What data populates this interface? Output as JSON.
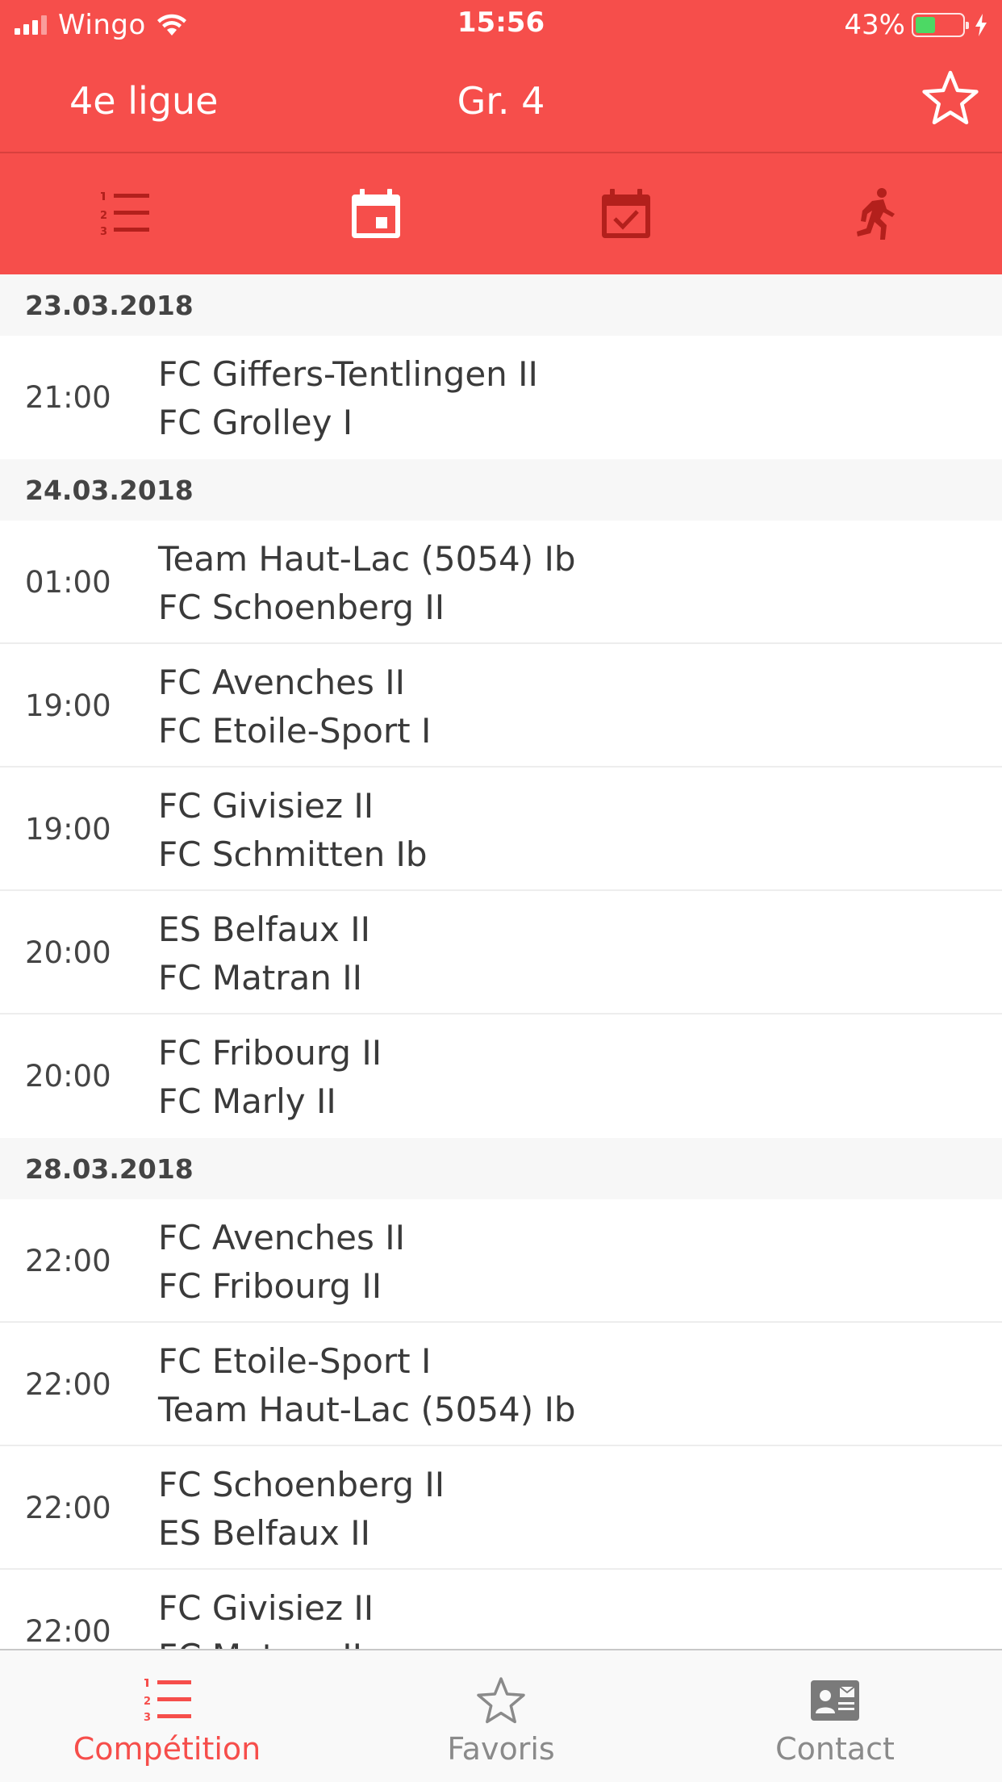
{
  "status_bar": {
    "carrier": "Wingo",
    "time": "15:56",
    "battery_percent": "43%",
    "battery_level": 0.43,
    "signal_bars": 3,
    "signal_bars_total": 4
  },
  "nav": {
    "left_title": "4e ligue",
    "center_title": "Gr. 4",
    "favorite_icon": "star-outline-icon"
  },
  "segments": [
    {
      "name": "ranking-list-icon",
      "active": false
    },
    {
      "name": "calendar-icon",
      "active": true
    },
    {
      "name": "calendar-check-icon",
      "active": false
    },
    {
      "name": "runner-icon",
      "active": false
    }
  ],
  "schedule": [
    {
      "date": "23.03.2018",
      "matches": [
        {
          "time": "21:00",
          "home": "FC Giffers-Tentlingen II",
          "away": "FC Grolley I"
        }
      ]
    },
    {
      "date": "24.03.2018",
      "matches": [
        {
          "time": "01:00",
          "home": "Team Haut-Lac (5054) Ib",
          "away": "FC Schoenberg II"
        },
        {
          "time": "19:00",
          "home": "FC Avenches II",
          "away": "FC Etoile-Sport I"
        },
        {
          "time": "19:00",
          "home": "FC Givisiez II",
          "away": "FC Schmitten Ib"
        },
        {
          "time": "20:00",
          "home": "ES Belfaux II",
          "away": "FC Matran II"
        },
        {
          "time": "20:00",
          "home": "FC Fribourg II",
          "away": "FC Marly II"
        }
      ]
    },
    {
      "date": "28.03.2018",
      "matches": [
        {
          "time": "22:00",
          "home": "FC Avenches II",
          "away": "FC Fribourg II"
        },
        {
          "time": "22:00",
          "home": "FC Etoile-Sport I",
          "away": "Team Haut-Lac (5054) Ib"
        },
        {
          "time": "22:00",
          "home": "FC Schoenberg II",
          "away": "ES Belfaux II"
        },
        {
          "time": "22:00",
          "home": "FC Givisiez II",
          "away": "FC Matran II"
        }
      ]
    }
  ],
  "tabs": [
    {
      "label": "Compétition",
      "icon": "ranking-list-icon",
      "active": true
    },
    {
      "label": "Favoris",
      "icon": "star-outline-icon",
      "active": false
    },
    {
      "label": "Contact",
      "icon": "contact-card-icon",
      "active": false
    }
  ],
  "colors": {
    "brand_red": "#f64e4b",
    "active_icon_dark_red": "#b3201c",
    "battery_green": "#4cd964",
    "date_header_bg": "#f7f7f7"
  }
}
